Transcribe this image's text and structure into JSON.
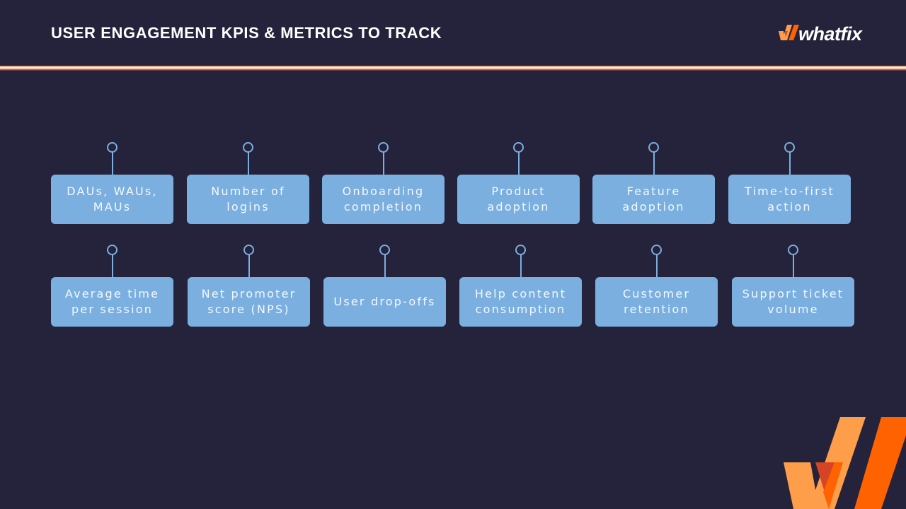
{
  "header": {
    "title": "USER ENGAGEMENT KPIS & METRICS TO TRACK",
    "brand_name": "whatfix"
  },
  "colors": {
    "background": "#25233b",
    "box_fill": "#7aafe0",
    "box_text": "#f4f8ff",
    "brand_light_orange": "#ff9e4a",
    "brand_orange": "#ff6200",
    "brand_red": "#d64523"
  },
  "kpis": {
    "row1": [
      {
        "label": "DAUs, WAUs, MAUs"
      },
      {
        "label": "Number of logins"
      },
      {
        "label": "Onboarding completion"
      },
      {
        "label": "Product adoption"
      },
      {
        "label": "Feature adoption"
      },
      {
        "label": "Time-to-first action"
      }
    ],
    "row2": [
      {
        "label": "Average time per session"
      },
      {
        "label": "Net promoter score (NPS)"
      },
      {
        "label": "User drop-offs"
      },
      {
        "label": "Help content consumption"
      },
      {
        "label": "Customer retention"
      },
      {
        "label": "Support ticket volume"
      }
    ]
  }
}
